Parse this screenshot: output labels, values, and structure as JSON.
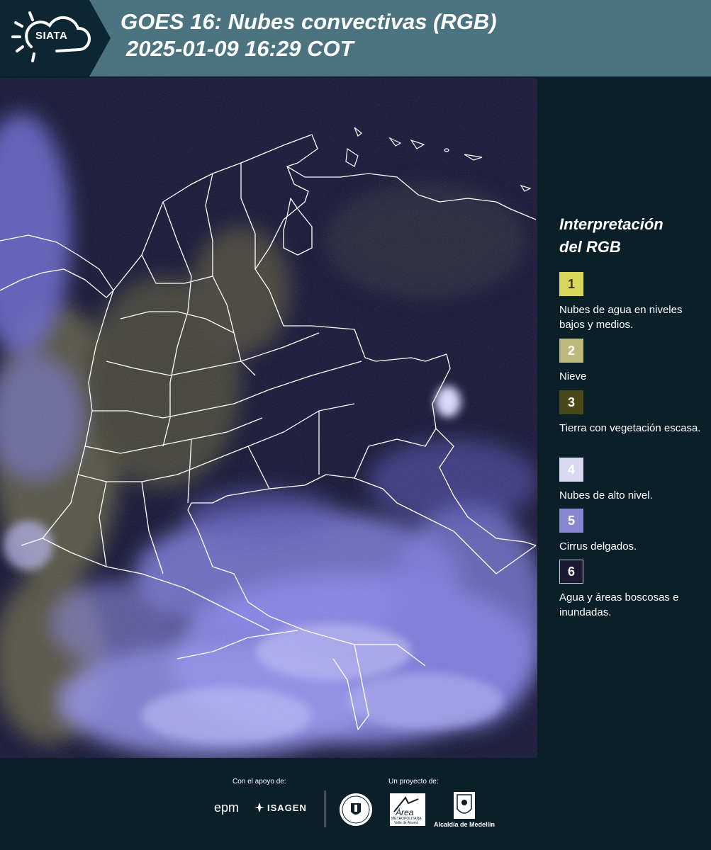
{
  "header": {
    "logo_text": "SIATA",
    "title_line1": "GOES 16: Nubes convectivas (RGB)",
    "title_line2": "2025-01-09 16:29 COT"
  },
  "legend": {
    "title_line1": "Interpretación",
    "title_line2": "del RGB",
    "items": [
      {
        "number": "1",
        "label": "Nubes de agua en niveles bajos y medios.",
        "color": "#d8d75a",
        "text_color": "#3a3a10"
      },
      {
        "number": "2",
        "label": "Nieve",
        "color": "#bcb97a",
        "text_color": "#ffffff"
      },
      {
        "number": "3",
        "label": "Tierra con vegetación escasa.",
        "color": "#4a4718",
        "text_color": "#ffffff"
      },
      {
        "number": "4",
        "label": "Nubes de alto nivel.",
        "color": "#d9d8f3",
        "text_color": "#ffffff"
      },
      {
        "number": "5",
        "label": "Cirrus delgados.",
        "color": "#8886d2",
        "text_color": "#ffffff"
      },
      {
        "number": "6",
        "label": "Agua y áreas boscosas e inundadas.",
        "color": "#1c1a33",
        "text_color": "#ffffff",
        "border": "#c9c9d6"
      }
    ]
  },
  "footer": {
    "support_label": "Con el apoyo de:",
    "project_label": "Un proyecto de:",
    "sponsor1": "epm",
    "sponsor2": "ISAGEN",
    "partner_area": "Área",
    "partner_area_sub1": "METROPOLITANA",
    "partner_area_sub2": "Valle de Aburrá",
    "partner_alcaldia": "Alcaldía de Medellín"
  },
  "colors": {
    "header_bg": "#4b7380",
    "logo_bg": "#0d2633",
    "page_bg": "#0b1f29",
    "map_bg": "#1a1a3c"
  }
}
